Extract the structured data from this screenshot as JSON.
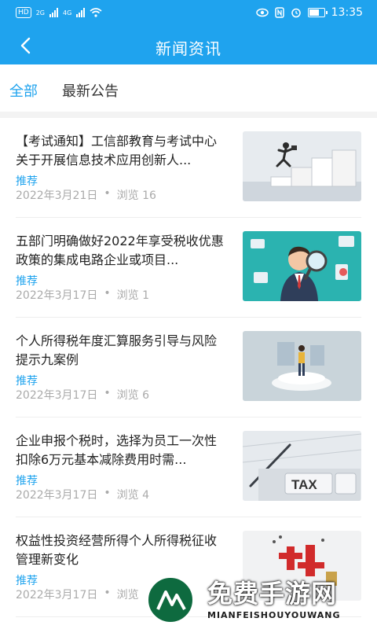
{
  "status_bar": {
    "hd_label": "HD",
    "network_1": "2G",
    "network_2": "4G",
    "time": "13:35",
    "battery_level": 0.7,
    "icons": [
      "eye-icon",
      "nfc-icon",
      "alarm-icon",
      "battery-icon",
      "wifi-icon",
      "signal-icon"
    ]
  },
  "nav": {
    "title": "新闻资讯",
    "back_icon": "chevron-left-icon"
  },
  "tabs": [
    {
      "label": "全部",
      "active": true
    },
    {
      "label": "最新公告",
      "active": false
    }
  ],
  "colors": {
    "accent": "#1fa3ee",
    "tag": "#1fa3ee",
    "meta": "#aaaaaa"
  },
  "news": [
    {
      "title": "【考试通知】工信部教育与考试中心关于开展信息技术应用创新人...",
      "tag": "推荐",
      "date": "2022年3月21日",
      "dot": "•",
      "views": "浏览 16",
      "image": "businessman-jumping-steps"
    },
    {
      "title": "五部门明确做好2022年享受税收优惠政策的集成电路企业或项目...",
      "tag": "推荐",
      "date": "2022年3月17日",
      "dot": "•",
      "views": "浏览 1",
      "image": "man-with-magnifier"
    },
    {
      "title": "个人所得税年度汇算服务引导与风险提示九案例",
      "tag": "推荐",
      "date": "2022年3月17日",
      "dot": "•",
      "views": "浏览 6",
      "image": "man-on-podium"
    },
    {
      "title": "企业申报个税时，选择为员工一次性扣除6万元基本减除费用时需...",
      "tag": "推荐",
      "date": "2022年3月17日",
      "dot": "•",
      "views": "浏览 4",
      "image": "tax-keyboard"
    },
    {
      "title": "权益性投资经营所得个人所得税征收管理新变化",
      "tag": "推荐",
      "date": "2022年3月17日",
      "dot": "•",
      "views": "浏览",
      "image": "tax-character-art"
    }
  ],
  "watermark": {
    "title": "免费手游网",
    "subtitle": "MIANFEISHOUYOUWANG"
  }
}
